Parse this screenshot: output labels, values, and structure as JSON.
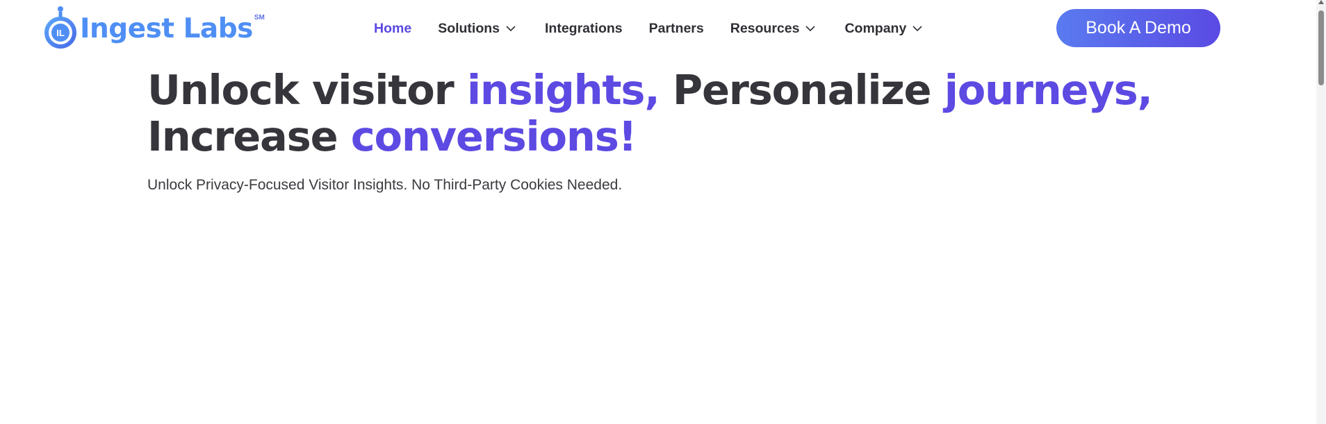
{
  "brand": {
    "name": "Ingest Labs",
    "mark_text": "IL",
    "sm": "SM",
    "color": "#4f8ff5"
  },
  "nav": {
    "items": [
      {
        "label": "Home",
        "active": true
      },
      {
        "label": "Solutions",
        "dropdown": true
      },
      {
        "label": "Integrations"
      },
      {
        "label": "Partners"
      },
      {
        "label": "Resources",
        "dropdown": true
      },
      {
        "label": "Company",
        "dropdown": true
      }
    ]
  },
  "cta": {
    "label": "Book A Demo"
  },
  "hero": {
    "headline": {
      "p1": "Unlock visitor ",
      "a1": "insights,",
      "p2": " Personalize ",
      "a2": "journeys,",
      "p3": "Increase ",
      "a3": "conversions!"
    },
    "subheadline": "Unlock Privacy-Focused Visitor Insights. No Third-Party Cookies Needed."
  },
  "colors": {
    "accent": "#5d4ae2",
    "text": "#35353b",
    "button_gradient_start": "#5a7bf0",
    "button_gradient_end": "#5a4ae3"
  }
}
